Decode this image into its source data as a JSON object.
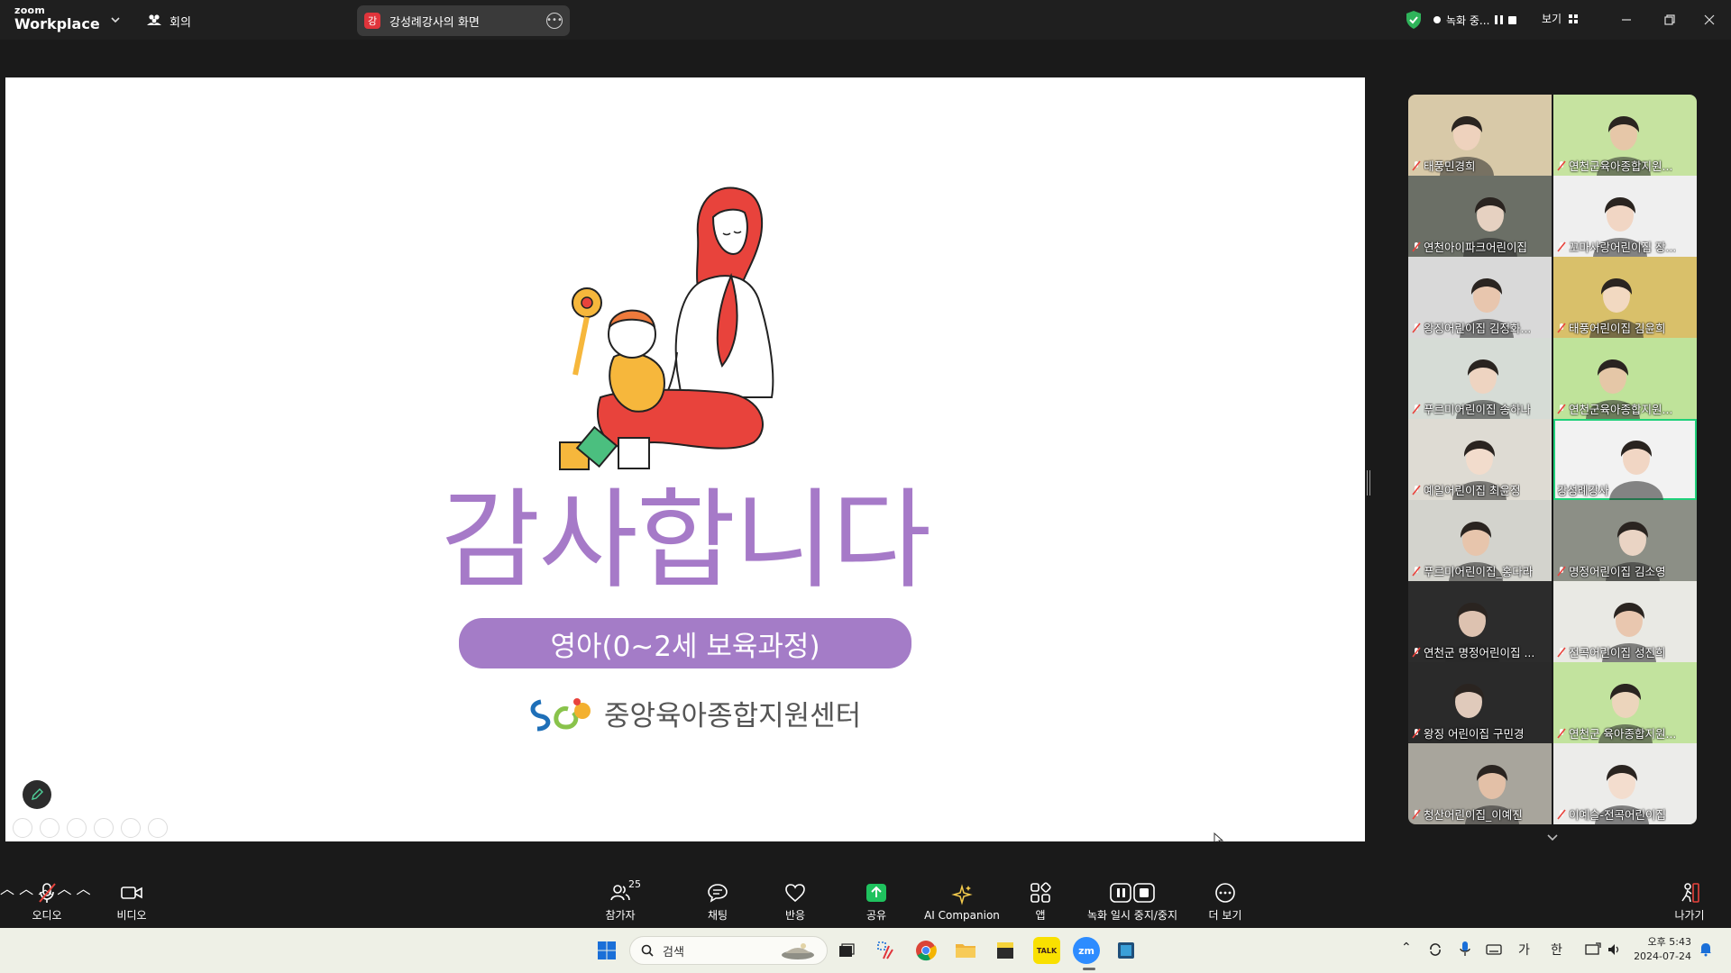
{
  "titlebar": {
    "brand_top": "zoom",
    "brand_bottom": "Workplace",
    "meeting_label": "회의",
    "share_initial": "강",
    "share_title": "강성례강사의 화면",
    "recording_label": "녹화 중...",
    "view_label": "보기"
  },
  "slide": {
    "thanks": "감사합니다",
    "subtitle": "영아(0~2세 보육과정)",
    "org_name": "중앙육아종합지원센터",
    "colors": {
      "accent": "#a67ac8",
      "pill": "#a47cc7"
    }
  },
  "participants": [
    {
      "name": "태풍민경희",
      "bg": "#d8c9a8",
      "active": false
    },
    {
      "name": "연천군육아종합지원...",
      "bg": "#c6e3a0",
      "active": false
    },
    {
      "name": "연천아이파크어린이집",
      "bg": "#6b6f66",
      "active": false
    },
    {
      "name": "꼬마사랑어린이집 장...",
      "bg": "#efefef",
      "active": false
    },
    {
      "name": "왕징어린이집 김정화...",
      "bg": "#d9d9d9",
      "active": false
    },
    {
      "name": "태풍어린이집 김윤희",
      "bg": "#d9c06a",
      "active": false
    },
    {
      "name": "푸르미어린이집 송하나",
      "bg": "#d6dcd6",
      "active": false
    },
    {
      "name": "연천군육아종합지원...",
      "bg": "#bfe39a",
      "active": false
    },
    {
      "name": "예일어린이집 최윤정",
      "bg": "#dedbd3",
      "active": false
    },
    {
      "name": "강성례강사",
      "bg": "#f2f2f2",
      "active": true
    },
    {
      "name": "푸르미어린이집_홍다라",
      "bg": "#d3d3cd",
      "active": false
    },
    {
      "name": "명정어린이집 김소영",
      "bg": "#8c8f86",
      "active": false
    },
    {
      "name": "연천군 명정어린이집 ...",
      "bg": "#2c2c2c",
      "active": false
    },
    {
      "name": "전곡어린이집 성진희",
      "bg": "#e9e9e4",
      "active": false
    },
    {
      "name": "왕징 어린이집 구민경",
      "bg": "#2a2a2a",
      "active": false
    },
    {
      "name": "연천군 육아종합지원...",
      "bg": "#c2e39e",
      "active": false
    },
    {
      "name": "청산어린이집_이예진",
      "bg": "#a8a59c",
      "active": false
    },
    {
      "name": "이예슬-전곡어린이집",
      "bg": "#ececea",
      "active": false
    }
  ],
  "toolbar": {
    "audio": "오디오",
    "video": "비디오",
    "participants": "참가자",
    "participants_count": "25",
    "chat": "채팅",
    "reactions": "반응",
    "share": "공유",
    "ai": "AI Companion",
    "apps": "앱",
    "record": "녹화 일시 중지/중지",
    "more": "더 보기",
    "leave": "나가기"
  },
  "taskbar": {
    "search_placeholder": "검색",
    "ime_lang": "가",
    "ime_mode": "한",
    "time": "오후 5:43",
    "date": "2024-07-24",
    "talk_label": "TALK",
    "zm_label": "zm"
  }
}
